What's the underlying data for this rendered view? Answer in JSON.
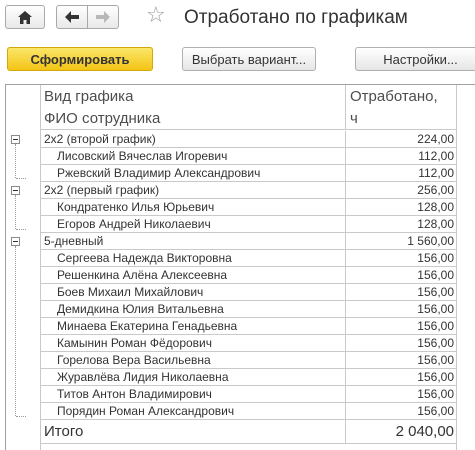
{
  "window": {
    "title": "Отработано по графикам"
  },
  "toolbar": {
    "generate_label": "Сформировать",
    "variant_label": "Выбрать вариант...",
    "settings_label": "Настройки..."
  },
  "report": {
    "header": {
      "col1_line1": "Вид графика",
      "col1_line2": "ФИО сотрудника",
      "col2_line1": "Отработано,",
      "col2_line2": "ч"
    },
    "groups": [
      {
        "name": "2x2 (второй график)",
        "value": "224,00",
        "items": [
          {
            "name": "Лисовский Вячеслав Игоревич",
            "value": "112,00"
          },
          {
            "name": "Ржевский Владимир Александрович",
            "value": "112,00"
          }
        ]
      },
      {
        "name": "2x2 (первый график)",
        "value": "256,00",
        "items": [
          {
            "name": "Кондратенко Илья Юрьевич",
            "value": "128,00"
          },
          {
            "name": "Егоров Андрей Николаевич",
            "value": "128,00"
          }
        ]
      },
      {
        "name": "5-дневный",
        "value": "1 560,00",
        "items": [
          {
            "name": "Сергеева Надежда Викторовна",
            "value": "156,00"
          },
          {
            "name": "Решенкина Алёна Алексеевна",
            "value": "156,00"
          },
          {
            "name": "Боев Михаил Михайлович",
            "value": "156,00"
          },
          {
            "name": "Демидкина Юлия Витальевна",
            "value": "156,00"
          },
          {
            "name": "Минаева Екатерина Генадьевна",
            "value": "156,00"
          },
          {
            "name": "Камынин Роман Фёдорович",
            "value": "156,00"
          },
          {
            "name": "Горелова Вера Васильевна",
            "value": "156,00"
          },
          {
            "name": "Журавлёва Лидия Николаевна",
            "value": "156,00"
          },
          {
            "name": "Титов Антон Владимирович",
            "value": "156,00"
          },
          {
            "name": "Порядин Роман Александрович",
            "value": "156,00"
          }
        ]
      }
    ],
    "total": {
      "label": "Итого",
      "value": "2 040,00"
    }
  },
  "colors": {
    "primary_button": "#f3c415",
    "grid_line": "#c9c9c9",
    "text": "#333333"
  }
}
